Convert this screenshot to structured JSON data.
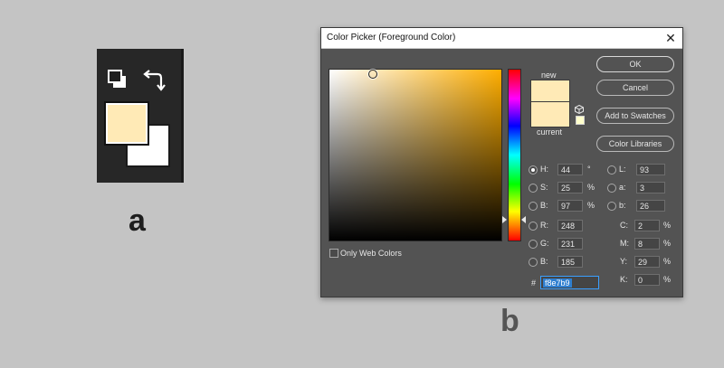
{
  "captions": {
    "a": "a",
    "b": "b"
  },
  "colors": {
    "foreground": "#ffeab6",
    "background": "#ffffff",
    "hue_pure": "#ffae00"
  },
  "dialog": {
    "title": "Color Picker (Foreground Color)",
    "close": "✕",
    "labels": {
      "new": "new",
      "current": "current"
    },
    "buttons": {
      "ok": "OK",
      "cancel": "Cancel",
      "add_to_swatches": "Add to Swatches",
      "color_libraries": "Color Libraries"
    },
    "only_web_colors": "Only Web Colors",
    "hsb": [
      {
        "key": "H:",
        "value": "44",
        "unit": "°"
      },
      {
        "key": "S:",
        "value": "25",
        "unit": "%"
      },
      {
        "key": "B:",
        "value": "97",
        "unit": "%"
      }
    ],
    "rgb": [
      {
        "key": "R:",
        "value": "248"
      },
      {
        "key": "G:",
        "value": "231"
      },
      {
        "key": "B:",
        "value": "185"
      }
    ],
    "lab": [
      {
        "key": "L:",
        "value": "93"
      },
      {
        "key": "a:",
        "value": "3"
      },
      {
        "key": "b:",
        "value": "26"
      }
    ],
    "cmyk": [
      {
        "key": "C:",
        "value": "2",
        "unit": "%"
      },
      {
        "key": "M:",
        "value": "8",
        "unit": "%"
      },
      {
        "key": "Y:",
        "value": "29",
        "unit": "%"
      },
      {
        "key": "K:",
        "value": "0",
        "unit": "%"
      }
    ],
    "hex": {
      "hash": "#",
      "value": "f8e7b9"
    }
  },
  "icons": {
    "default_colors": "default-colors-icon",
    "swap": "swap-colors-icon",
    "gamut_cube": "websafe-cube-icon"
  }
}
